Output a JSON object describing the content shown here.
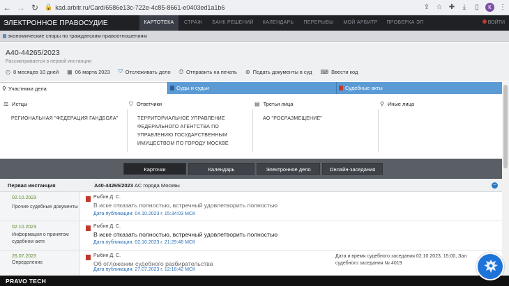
{
  "browser": {
    "url": "kad.arbitr.ru/Card/6586e13c-722e-4c85-8661-e0403ed1a1b6",
    "profile_initial": "К"
  },
  "topbar": {
    "brand": "ЭЛЕКТРОННОЕ ПРАВОСУДИЕ",
    "tabs": [
      "КАРТОТЕКА",
      "СТРАЖ",
      "БАНК РЕШЕНИЙ",
      "КАЛЕНДАРЬ",
      "ПЕРЕРЫВЫ",
      "МОЙ АРБИТР",
      "ПРОВЕРКА ЭП"
    ],
    "active_tab": "КАРТОТЕКА",
    "exit": "ВОЙТИ"
  },
  "category": "экономические споры по гражданским правоотношениям",
  "case": {
    "number": "А40-44265/2023",
    "status": "Рассматривается в первой инстанции",
    "duration": "8 месяцев 10 дней",
    "date": "06 марта 2023",
    "actions": [
      "Отслеживать дело",
      "Отправить на печать",
      "Подать документы в суд",
      "Ввести код"
    ]
  },
  "section_tabs": [
    "Участники дела",
    "Суды и судьи",
    "Судебные акты"
  ],
  "participants": {
    "plaintiffs": {
      "title": "Истцы",
      "items": [
        "РЕГИОНАЛЬНАЯ \"ФЕДЕРАЦИЯ ГАНДБОЛА\""
      ]
    },
    "defendants": {
      "title": "Ответчики",
      "items": [
        "ТЕРРИТОРИАЛЬНОЕ УПРАВЛЕНИЕ",
        "ФЕДЕРАЛЬНОГО АГЕНТСТВА ПО",
        "УПРАВЛЕНИЮ ГОСУДАРСТВЕННЫМ",
        "ИМУЩЕСТВОМ ПО ГОРОДУ МОСКВЕ"
      ]
    },
    "third": {
      "title": "Третьи лица",
      "items": [
        "АО \"РОСРАЗМЕЩЕНИЕ\""
      ]
    },
    "other": {
      "title": "Иные лица",
      "items": []
    }
  },
  "bottom_tabs": [
    "Карточки",
    "Календарь",
    "Электронное дело",
    "Онлайн-заседания"
  ],
  "instance": {
    "label": "Первая инстанция",
    "case_ref": "А40-44265/2023",
    "court": "АС города Москвы"
  },
  "documents": [
    {
      "date": "02.10.2023",
      "kind": "Прочие судебные документы",
      "judge": "Рыбин Д. С.",
      "summary": "В иске отказать полностью, встречный удовлетворить полностью",
      "published": "Дата публикации: 04.10.2023 г. 15:34:03 МСК",
      "extra": ""
    },
    {
      "date": "02.10.2023",
      "kind": "Информация о принятом судебном акте",
      "judge": "Рыбин Д. С.",
      "summary": "В иске отказать полностью, встречный удовлетворить полностью",
      "published": "Дата публикации: 02.10.2023 г. 21:29:46 МСК",
      "extra": ""
    },
    {
      "date": "26.07.2023",
      "kind": "Определение",
      "judge": "Рыбин Д. С.",
      "summary": "Об отложении судебного разбирательства",
      "published": "Дата публикации: 27.07.2023 г. 12:18:42 МСК",
      "extra": "Дата и время судебного заседания 02.10.2023, 15:00, Зал судебного заседания № 4019"
    }
  ],
  "footer": "PRAVO TECH"
}
